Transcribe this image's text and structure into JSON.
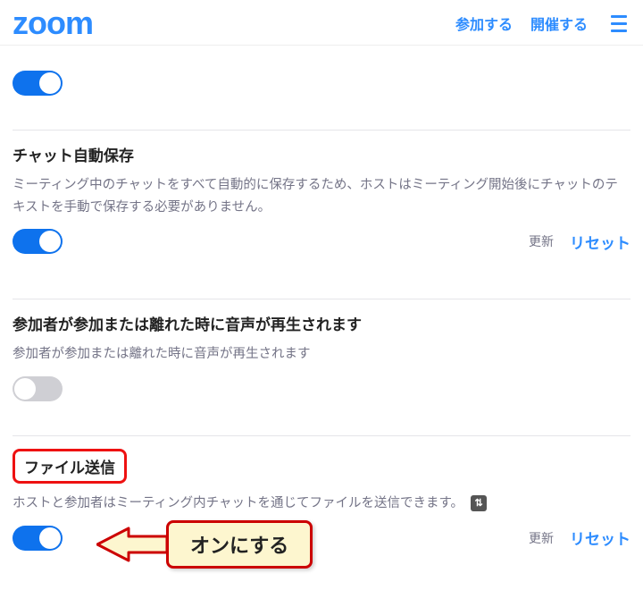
{
  "header": {
    "logo_text": "zoom",
    "link_join": "参加する",
    "link_host": "開催する"
  },
  "sections": {
    "s1": {
      "toggle_on": true
    },
    "s2": {
      "title": "チャット自動保存",
      "desc": "ミーティング中のチャットをすべて自動的に保存するため、ホストはミーティング開始後にチャットのテキストを手動で保存する必要がありません。",
      "toggle_on": true,
      "update_label": "更新",
      "reset_label": "リセット"
    },
    "s3": {
      "title": "参加者が参加または離れた時に音声が再生されます",
      "desc": "参加者が参加または離れた時に音声が再生されます",
      "toggle_on": false
    },
    "s4": {
      "title": "ファイル送信",
      "desc": "ホストと参加者はミーティング内チャットを通じてファイルを送信できます。",
      "icon_glyph": "⇅",
      "toggle_on": true,
      "update_label": "更新",
      "reset_label": "リセット",
      "callout": "オンにする"
    }
  }
}
